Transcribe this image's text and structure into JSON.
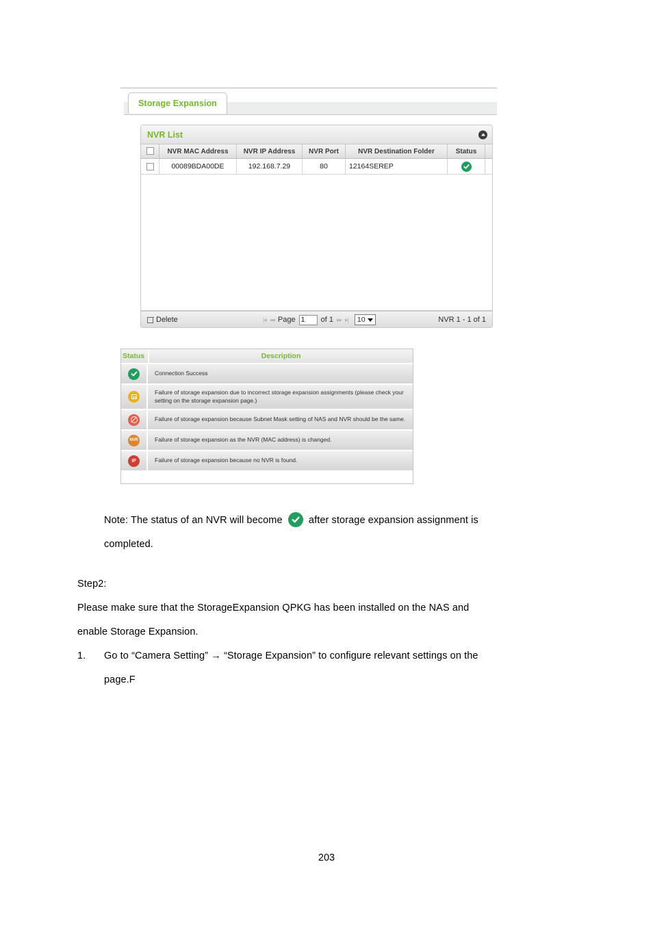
{
  "screenshot": {
    "tab": {
      "label": "Storage Expansion"
    },
    "panel": {
      "title": "NVR List",
      "collapse_icon": "chevron-up-icon",
      "columns": [
        "",
        "NVR MAC Address",
        "NVR IP Address",
        "NVR Port",
        "NVR Destination Folder",
        "Status",
        ""
      ],
      "rows": [
        {
          "mac": "00089BDA00DE",
          "ip": "192.168.7.29",
          "port": "80",
          "destination_folder": "12164SEREP",
          "status_icon": "status-success-icon"
        }
      ],
      "footer": {
        "delete_label": "Delete",
        "first_page_icon": "first-page-icon",
        "prev_page_icon": "prev-page-icon",
        "page_label": "Page",
        "page_value": "1",
        "of_label": "of 1",
        "next_page_icon": "next-page-icon",
        "last_page_icon": "last-page-icon",
        "page_size_value": "10",
        "record_range": "NVR 1 - 1 of 1"
      }
    }
  },
  "legend": {
    "header": {
      "status": "Status",
      "description": "Description"
    },
    "rows": [
      {
        "icon": "status-success-icon",
        "icon_label": "",
        "description": "Connection Success"
      },
      {
        "icon": "status-folder-warning-icon",
        "icon_label": "",
        "description": "Failure of storage expansion due to incorrect storage expansion assignments (please check your setting on the storage expansion page.)"
      },
      {
        "icon": "status-subnet-error-icon",
        "icon_label": "",
        "description": "Failure of storage expansion because Subnet Mask setting of NAS and NVR should be the same."
      },
      {
        "icon": "status-nvr-changed-icon",
        "icon_label": "NVR",
        "description": "Failure of storage expansion as the NVR (MAC address) is changed."
      },
      {
        "icon": "status-ip-not-found-icon",
        "icon_label": "IP",
        "description": "Failure of storage expansion because no NVR is found."
      }
    ]
  },
  "document": {
    "note_part1": "Note: The status of an NVR will become",
    "note_icon": "status-success-icon",
    "note_part2": "after storage expansion assignment is",
    "note_line2": "completed.",
    "step2_heading": "Step2:",
    "step2_line1": "Please make sure that the StorageExpansion QPKG has been installed on the NAS and",
    "step2_line2": "enable Storage Expansion.",
    "item1_marker": "1.",
    "item1_line1": "Go to “Camera Setting” → “Storage Expansion” to configure relevant settings on the",
    "item1_line2": "page.F",
    "page_number": "203"
  },
  "colors": {
    "brand_green": "#76b82a",
    "success_green": "#1f9e5e",
    "warning_yellow": "#edb211",
    "error_red": "#ee5a4a",
    "nvr_orange": "#e08426",
    "ip_red": "#d33c33"
  }
}
